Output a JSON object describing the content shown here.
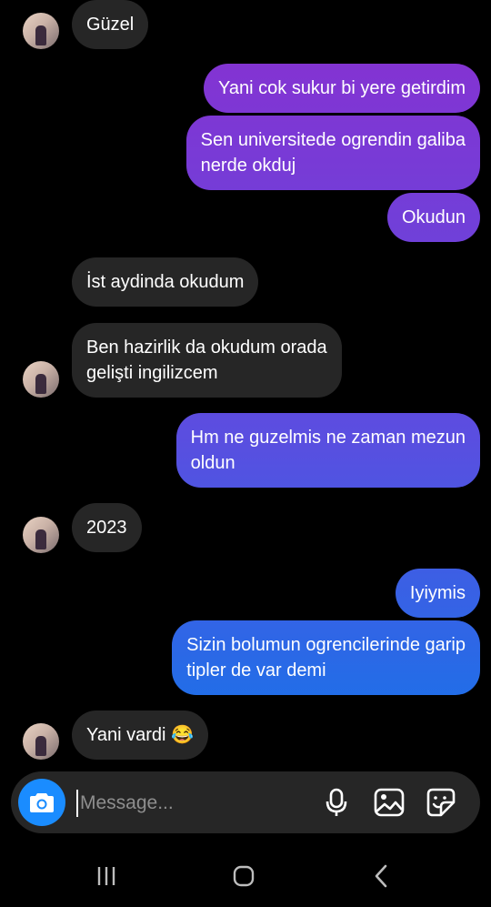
{
  "messages": [
    {
      "text": "Güzel",
      "direction": "incoming"
    },
    {
      "text": "Yani cok sukur bi yere getirdim",
      "direction": "outgoing"
    },
    {
      "text": "Sen universitede ogrendin galiba\nnerde okduj",
      "direction": "outgoing"
    },
    {
      "text": "Okudun",
      "direction": "outgoing"
    },
    {
      "text": "İst aydinda okudum",
      "direction": "incoming"
    },
    {
      "text": "Ben hazirlik da okudum orada\ngelişti ingilizcem",
      "direction": "incoming"
    },
    {
      "text": "Hm ne guzelmis ne zaman mezun\noldun",
      "direction": "outgoing"
    },
    {
      "text": "2023",
      "direction": "incoming"
    },
    {
      "text": "Iyiymis",
      "direction": "outgoing"
    },
    {
      "text": "Sizin bolumun ogrencilerinde garip\ntipler de var demi",
      "direction": "outgoing"
    },
    {
      "text": "Yani vardi 😂",
      "direction": "incoming"
    }
  ],
  "composer": {
    "placeholder": "Message...",
    "icons": [
      "camera-icon",
      "microphone-icon",
      "gallery-icon",
      "sticker-icon"
    ]
  },
  "navbar": {
    "icons": [
      "recent-apps-icon",
      "home-icon",
      "back-icon"
    ]
  },
  "colors": {
    "background": "#000000",
    "incoming_bubble": "#262626",
    "outgoing_gradient_top": "#8a2fd0",
    "outgoing_gradient_bottom": "#1f6fe8",
    "camera_button": "#1a8cff"
  }
}
